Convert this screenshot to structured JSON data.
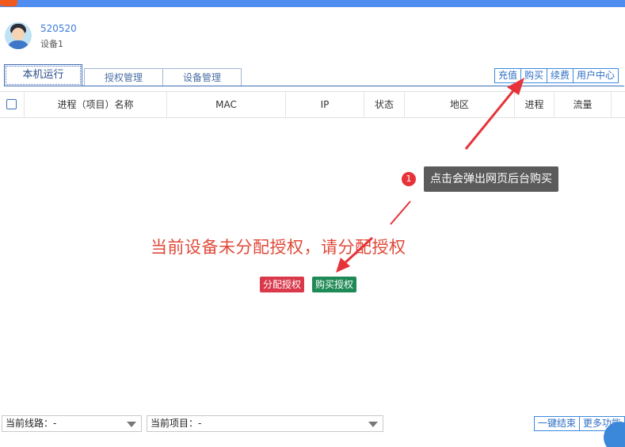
{
  "user": {
    "id": "520520",
    "device": "设备1"
  },
  "tabs": [
    {
      "label": "本机运行",
      "active": true
    },
    {
      "label": "授权管理",
      "active": false
    },
    {
      "label": "设备管理",
      "active": false
    }
  ],
  "top_buttons": [
    "充值",
    "购买",
    "续费",
    "用户中心"
  ],
  "table": {
    "columns": [
      "进程（项目）名称",
      "MAC",
      "IP",
      "状态",
      "地区",
      "进程",
      "流量"
    ]
  },
  "empty_message": "当前设备未分配授权，请分配授权",
  "actions": {
    "assign": "分配授权",
    "buy": "购买授权"
  },
  "tooltip": {
    "number": "1",
    "text": "点击会弹出网页后台购买"
  },
  "bottom": {
    "line_label": "当前线路：-",
    "project_label": "当前项目：-",
    "btn_end": "一键结束",
    "btn_more": "更多功能"
  },
  "colors": {
    "accent": "#3c8be0",
    "danger": "#d9394b",
    "success": "#1f8a55",
    "arrow": "#e6333a"
  }
}
